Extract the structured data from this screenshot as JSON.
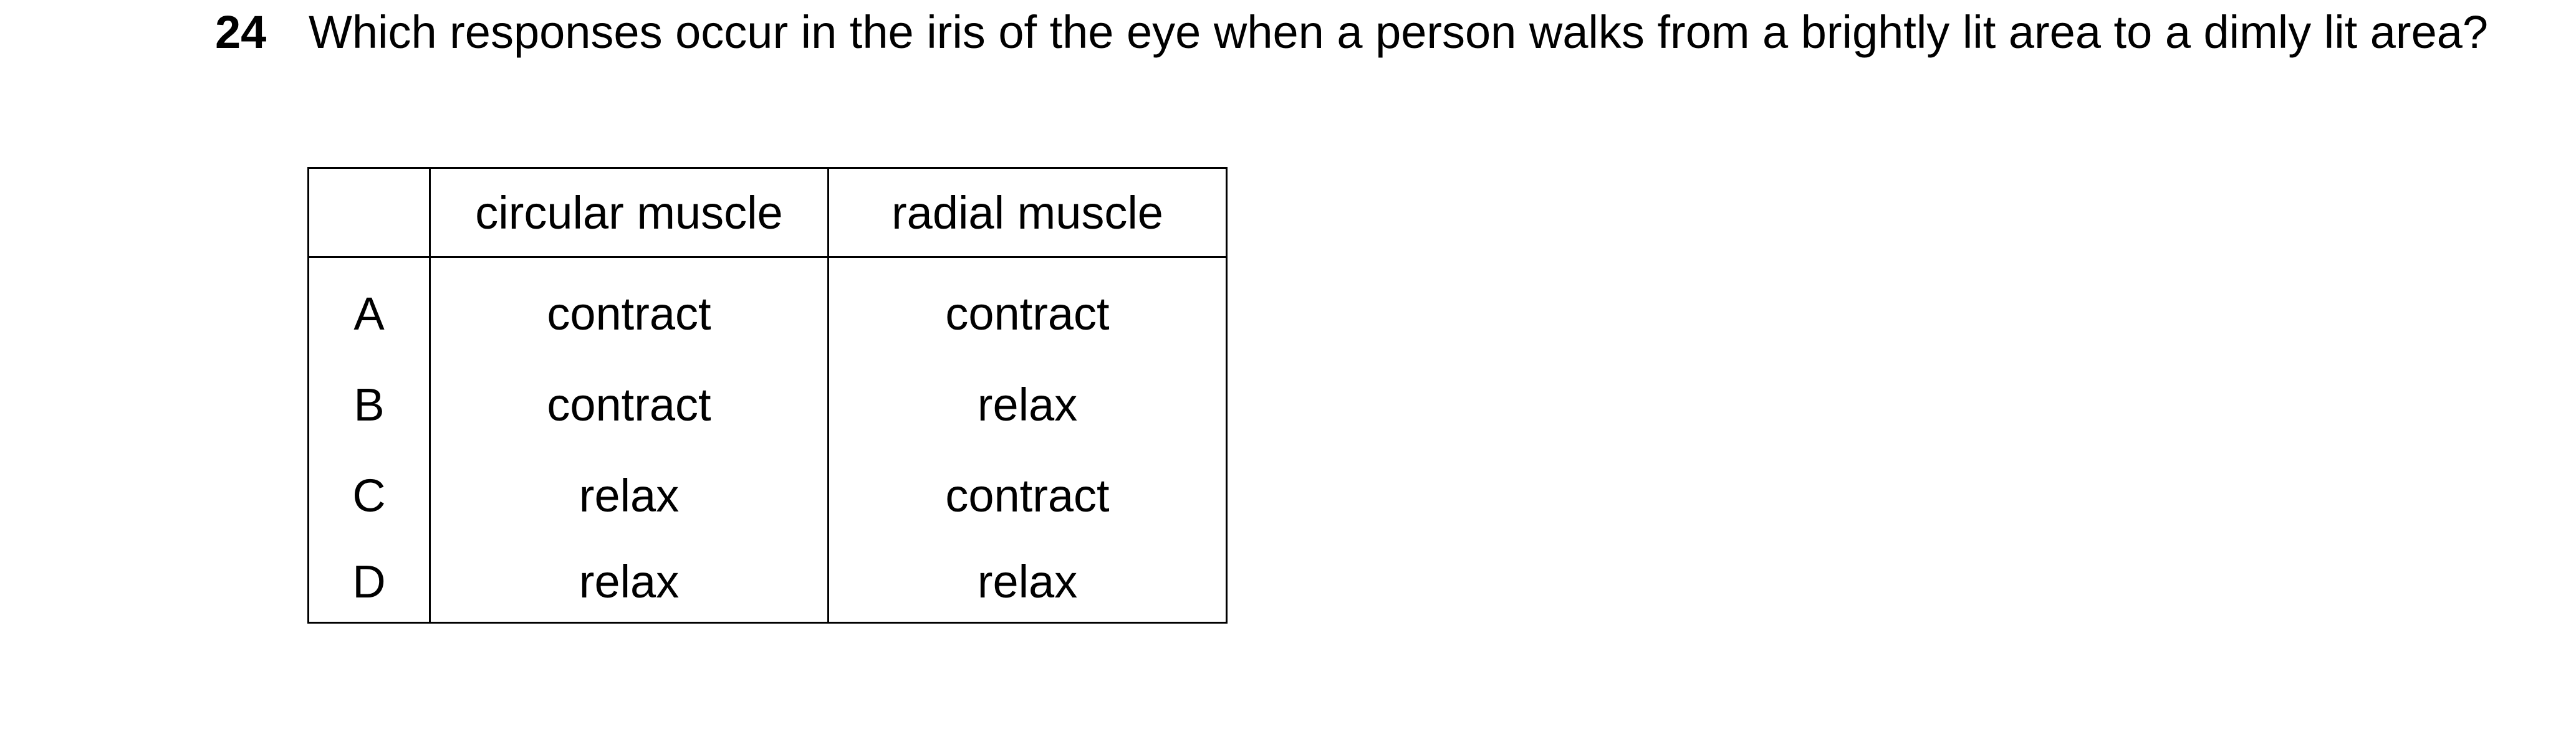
{
  "question": {
    "number": "24",
    "text": "Which responses occur in the iris of the eye when a person walks from a brightly lit area to a dimly lit area?"
  },
  "table": {
    "headers": [
      "",
      "circular muscle",
      "radial muscle"
    ],
    "rows": [
      {
        "letter": "A",
        "circular": "contract",
        "radial": "contract"
      },
      {
        "letter": "B",
        "circular": "contract",
        "radial": "relax"
      },
      {
        "letter": "C",
        "circular": "relax",
        "radial": "contract"
      },
      {
        "letter": "D",
        "circular": "relax",
        "radial": "relax"
      }
    ]
  }
}
